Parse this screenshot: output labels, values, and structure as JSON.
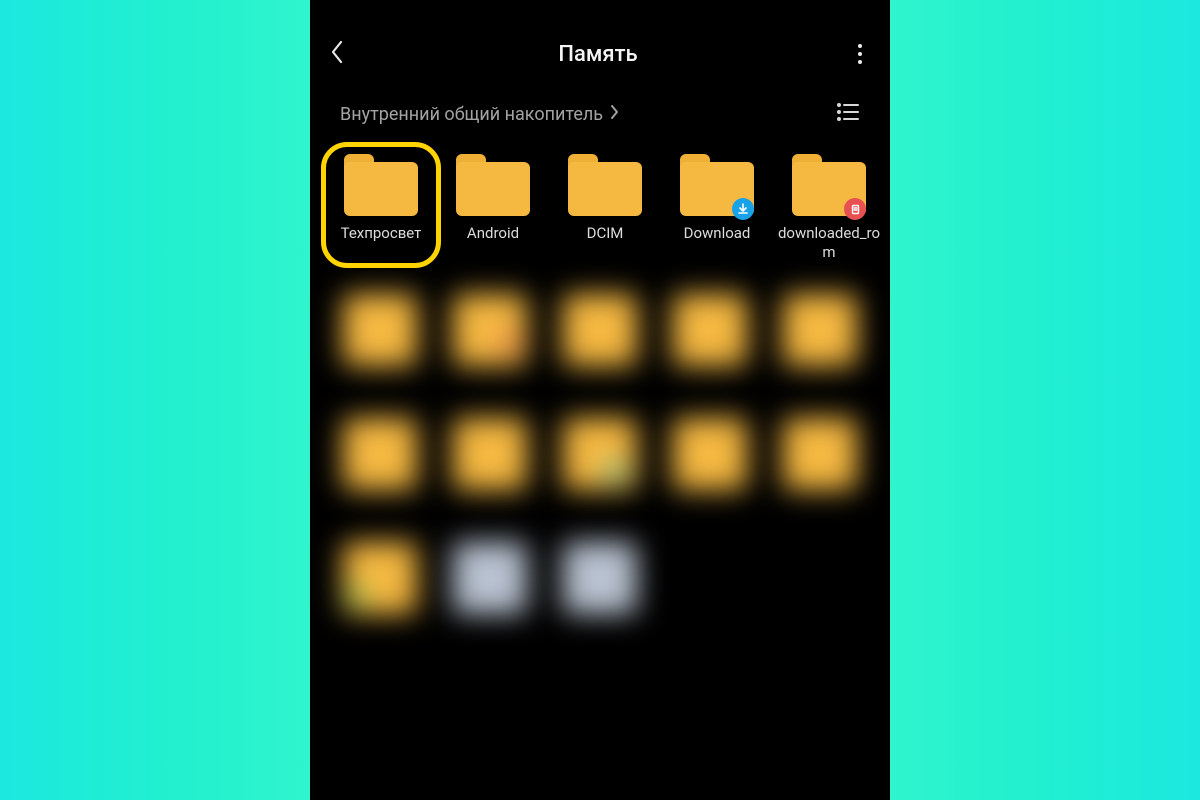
{
  "header": {
    "title": "Память"
  },
  "breadcrumb": {
    "path": "Внутренний общий накопитель"
  },
  "folders": [
    {
      "label": "Техпросвет",
      "highlight": true
    },
    {
      "label": "Android"
    },
    {
      "label": "DCIM"
    },
    {
      "label": "Download",
      "badge": "download"
    },
    {
      "label": "downloaded_rom",
      "badge": "file"
    }
  ]
}
